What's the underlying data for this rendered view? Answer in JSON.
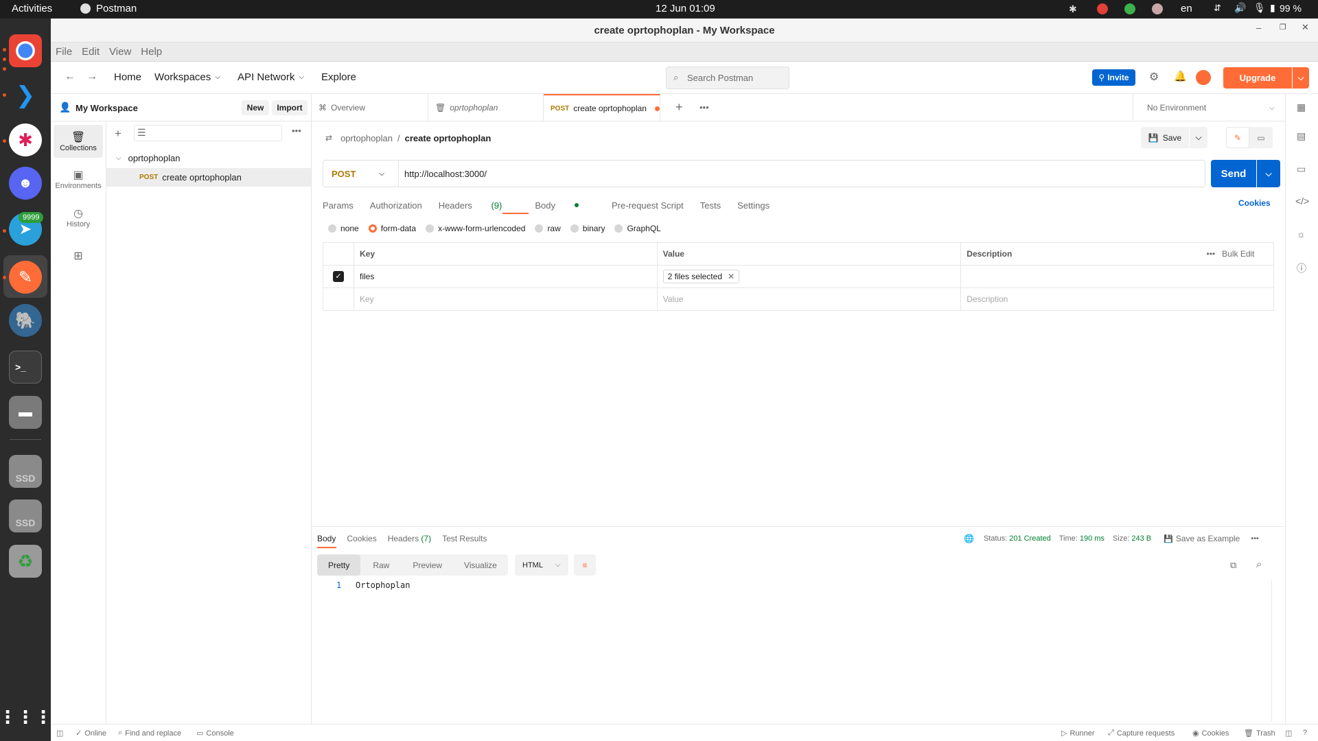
{
  "topbar": {
    "activities": "Activities",
    "app_name": "Postman",
    "datetime": "12 Jun  01:09",
    "lang": "en",
    "battery": "99 %"
  },
  "dock": {
    "telegram_badge": "9999",
    "ssd1": "SSD",
    "ssd2": "SSD"
  },
  "window": {
    "title": "create oprtophoplan - My Workspace"
  },
  "menu": [
    "File",
    "Edit",
    "View",
    "Help"
  ],
  "header": {
    "home": "Home",
    "workspaces": "Workspaces",
    "api_network": "API Network",
    "explore": "Explore",
    "search_placeholder": "Search Postman",
    "invite": "Invite",
    "upgrade": "Upgrade"
  },
  "workspace": {
    "name": "My Workspace",
    "new": "New",
    "import": "Import"
  },
  "nav": {
    "collections": "Collections",
    "environments": "Environments",
    "history": "History"
  },
  "tree": {
    "collection": "oprtophoplan",
    "method": "POST",
    "request": "create oprtophoplan"
  },
  "tabs": {
    "overview": "Overview",
    "collection": "oprtophoplan",
    "active_method": "POST",
    "active": "create oprtophoplan",
    "environment": "No Environment"
  },
  "breadcrumb": {
    "collection": "oprtophoplan",
    "sep": "/",
    "request": "create oprtophoplan",
    "save": "Save"
  },
  "request": {
    "method": "POST",
    "url": "http://localhost:3000/",
    "send": "Send"
  },
  "req_tabs": {
    "params": "Params",
    "authorization": "Authorization",
    "headers": "Headers",
    "headers_count": "(9)",
    "body": "Body",
    "prerequest": "Pre-request Script",
    "tests": "Tests",
    "settings": "Settings",
    "cookies": "Cookies"
  },
  "body_types": {
    "none": "none",
    "form_data": "form-data",
    "urlencoded": "x-www-form-urlencoded",
    "raw": "raw",
    "binary": "binary",
    "graphql": "GraphQL"
  },
  "table": {
    "headers": {
      "key": "Key",
      "value": "Value",
      "description": "Description",
      "bulk_edit": "Bulk Edit"
    },
    "row": {
      "key": "files",
      "value": "2 files selected"
    },
    "placeholders": {
      "key": "Key",
      "value": "Value",
      "description": "Description"
    }
  },
  "response": {
    "tabs": {
      "body": "Body",
      "cookies": "Cookies",
      "headers": "Headers",
      "headers_count": "(7)",
      "test_results": "Test Results"
    },
    "status_label": "Status:",
    "status": "201 Created",
    "time_label": "Time:",
    "time": "190 ms",
    "size_label": "Size:",
    "size": "243 B",
    "save_example": "Save as Example",
    "views": {
      "pretty": "Pretty",
      "raw": "Raw",
      "preview": "Preview",
      "visualize": "Visualize",
      "format": "HTML"
    },
    "line_no": "1",
    "content": "Ortophoplan"
  },
  "footer": {
    "online": "Online",
    "find_replace": "Find and replace",
    "console": "Console",
    "runner": "Runner",
    "capture": "Capture requests",
    "cookies": "Cookies",
    "trash": "Trash"
  },
  "colors": {
    "orange": "#ff6c37",
    "blue": "#0265d2",
    "green": "#007f31",
    "dock_bg": "#2c2c2c"
  }
}
